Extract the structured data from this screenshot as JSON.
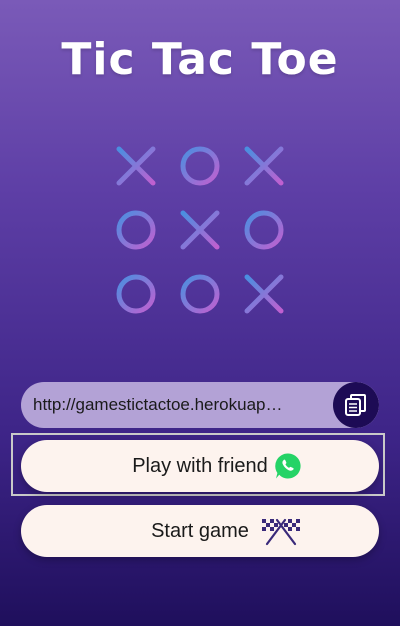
{
  "app": {
    "title": "Tic Tac Toe"
  },
  "board": {
    "cells": [
      "X",
      "O",
      "X",
      "O",
      "X",
      "O",
      "O",
      "O",
      "X"
    ]
  },
  "share": {
    "url_text": "http://gamestictactoe.herokuap…",
    "copy_icon": "copy-icon"
  },
  "buttons": {
    "play_with_friend_label": "Play with friend",
    "play_with_friend_icon": "whatsapp-icon",
    "start_game_label": "Start game",
    "start_game_icon": "racing-flags-icon"
  },
  "colors": {
    "whatsapp_green": "#25d366",
    "grid_gradient_start": "#4a8fe0",
    "grid_gradient_end": "#c060d0",
    "button_bg": "#fdf3ee"
  }
}
